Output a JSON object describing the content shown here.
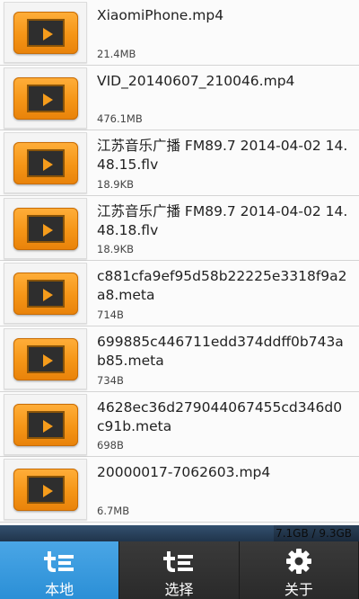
{
  "files": [
    {
      "name": "XiaomiPhone.mp4",
      "size": "21.4MB"
    },
    {
      "name": "VID_20140607_210046.mp4",
      "size": "476.1MB"
    },
    {
      "name": "江苏音乐广播 FM89.7 2014-04-02 14.48.15.flv",
      "size": "18.9KB"
    },
    {
      "name": "江苏音乐广播 FM89.7 2014-04-02 14.48.18.flv",
      "size": "18.9KB"
    },
    {
      "name": "c881cfa9ef95d58b22225e3318f9a2a8.meta",
      "size": "714B"
    },
    {
      "name": "699885c446711edd374ddff0b743ab85.meta",
      "size": "734B"
    },
    {
      "name": "4628ec36d279044067455cd346d0c91b.meta",
      "size": "698B"
    },
    {
      "name": "20000017-7062603.mp4",
      "size": "6.7MB"
    }
  ],
  "storage": {
    "text": "7.1GB / 9.3GB",
    "used_fraction": 0.763
  },
  "tabs": [
    {
      "label": "本地",
      "icon": "te-logo-icon",
      "active": true
    },
    {
      "label": "选择",
      "icon": "te-logo-icon",
      "active": false
    },
    {
      "label": "关于",
      "icon": "gear-icon",
      "active": false
    }
  ],
  "colors": {
    "accent": "#2b8fd6",
    "thumb": "#f59516"
  }
}
